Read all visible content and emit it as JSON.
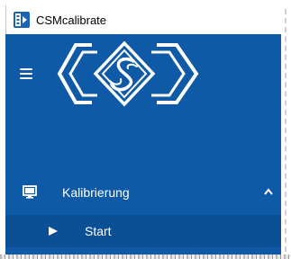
{
  "window": {
    "title": "CSMcalibrate"
  },
  "sidebar": {
    "logo_name": "csm-logo",
    "menu": [
      {
        "label": "Kalibrierung",
        "icon": "monitor-icon",
        "expanded": true,
        "children": [
          {
            "label": "Start",
            "icon": "play-icon"
          }
        ]
      }
    ]
  },
  "colors": {
    "sidebar_bg": "#0e5aa7",
    "submenu_bg": "#0b4f95",
    "text": "#ffffff"
  }
}
